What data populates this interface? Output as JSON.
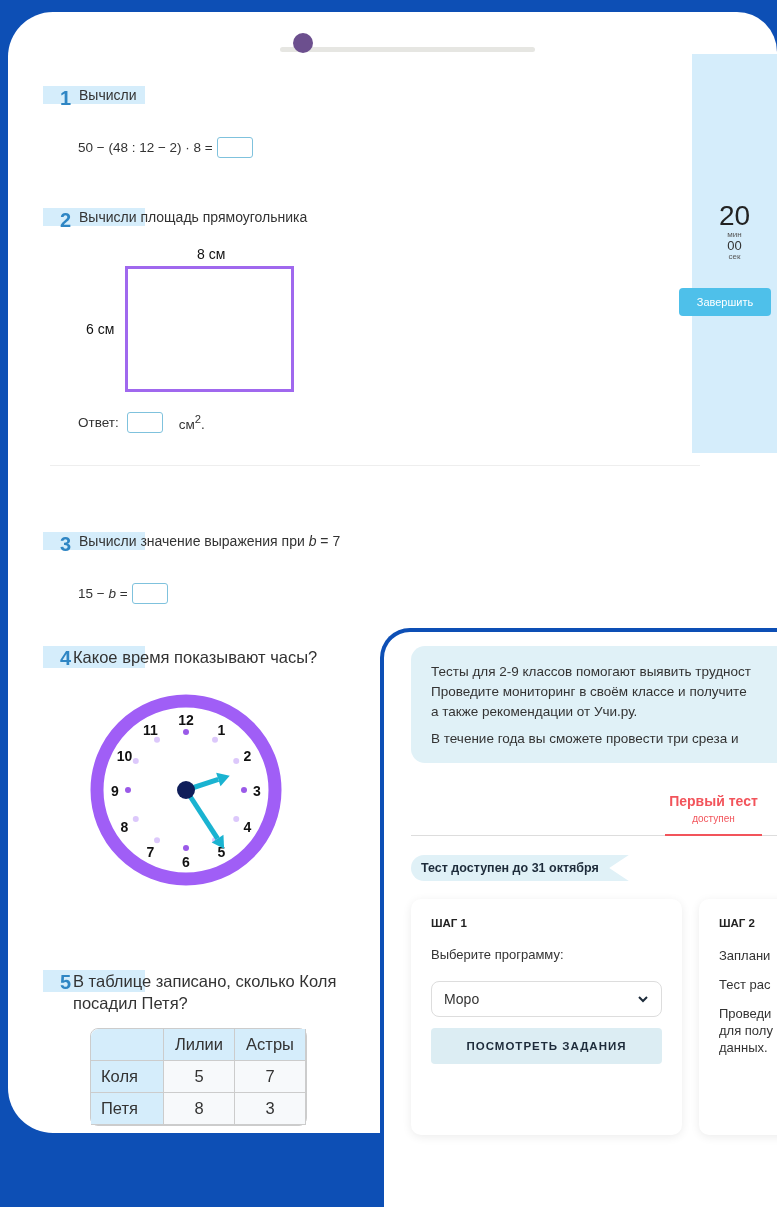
{
  "progress": {
    "level": 0.03
  },
  "timer": {
    "minutes": "20",
    "minutes_unit": "мин",
    "seconds": "00",
    "seconds_unit": "сек",
    "finish_button": "Завершить"
  },
  "questions": [
    {
      "kind": "equation",
      "number": "1",
      "title": "Вычисли",
      "expression": "50 − (48 : 12 − 2) · 8 ="
    },
    {
      "kind": "rectangle",
      "number": "2",
      "title": "Вычисли площадь прямоугольника",
      "width_label": "8 см",
      "height_label": "6 см",
      "answer_label": "Ответ:",
      "unit": "см$^{2}$."
    },
    {
      "kind": "equation",
      "number": "3",
      "title": "Вычисли значение выражения при *b* = 7",
      "expression": "15 − *b* ="
    },
    {
      "kind": "clock",
      "number": "4",
      "title": "Какое время показывают часы?",
      "clock_numbers": [
        "12",
        "1",
        "2",
        "3",
        "4",
        "5",
        "6",
        "7",
        "8",
        "9",
        "10",
        "11"
      ]
    },
    {
      "kind": "table",
      "number": "5",
      "title_lines": [
        "В таблице записано, сколько Коля",
        "посадил Петя?"
      ],
      "columns": [
        "Лилии",
        "Астры"
      ],
      "rows": [
        {
          "name": "Коля",
          "cells": [
            "5",
            "7"
          ]
        },
        {
          "name": "Петя",
          "cells": [
            "8",
            "3"
          ]
        }
      ]
    }
  ],
  "overlay": {
    "info_paragraphs": [
      [
        "Тесты для 2-9 классов помогают выявить трудност",
        "Проведите мониторинг в своём классе и получите",
        "а также рекомендации от Учи.ру."
      ],
      [
        "В течение года вы сможете провести три среза и"
      ]
    ],
    "tabs": [
      {
        "title": "Первый тест",
        "subtitle": "доступен",
        "selected": true
      }
    ],
    "deadline": "Тест доступен до 31 октября",
    "steps": [
      {
        "kind": "select",
        "label": "ШАГ 1",
        "prompt": "Выберите программу:",
        "select_value": "Моро",
        "button": "ПОСМОТРЕТЬ ЗАДАНИЯ"
      },
      {
        "kind": "text",
        "label": "ШАГ 2",
        "paragraphs": [
          [
            "Заплани"
          ],
          [
            "Тест рас"
          ],
          [
            "Проведи",
            "для полу",
            "данных."
          ]
        ]
      }
    ]
  }
}
